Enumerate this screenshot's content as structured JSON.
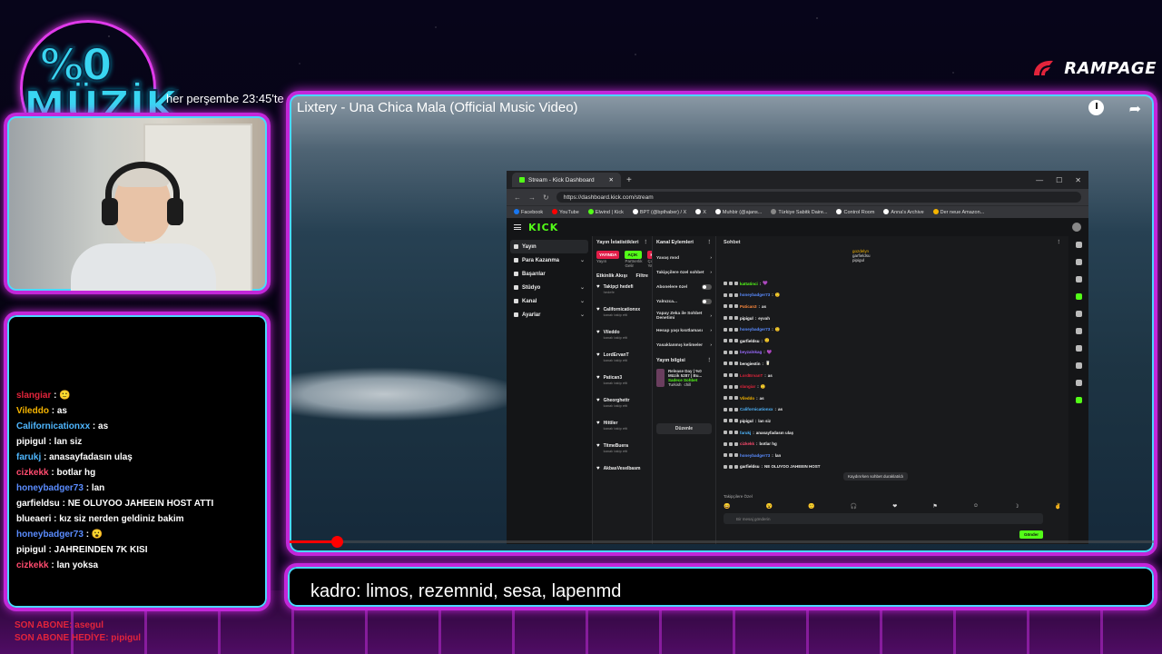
{
  "overlay": {
    "logo_top": "%0",
    "logo_bottom": "MÜZİK",
    "schedule": "her perşembe 23:45'te",
    "brand": "RAMPAGE",
    "caption": "kadro: limos, rezemnid, sesa, lapenmd",
    "subs": {
      "last_sub": "SON ABONE: asegul",
      "last_gift": "SON ABONE HEDİYE: pipigul"
    }
  },
  "stream_chat": [
    {
      "user": "slangiar",
      "color": "#e2243b",
      "msg": "🙂"
    },
    {
      "user": "Vileddo",
      "color": "#f5b400",
      "msg": "as"
    },
    {
      "user": "Californicationxx",
      "color": "#4fb7ff",
      "msg": "as"
    },
    {
      "user": "pipigul",
      "color": "#ffffff",
      "msg": "lan siz"
    },
    {
      "user": "farukj",
      "color": "#4fb7ff",
      "msg": "anasayfadasın ulaş"
    },
    {
      "user": "cizkekk",
      "color": "#ff4b6e",
      "msg": "botlar hg"
    },
    {
      "user": "honeybadger73",
      "color": "#5a8cff",
      "msg": "lan"
    },
    {
      "user": "garfieldsu",
      "color": "#ffffff",
      "msg": "NE OLUYOO JAHEEIN HOST ATTI"
    },
    {
      "user": "blueaeri",
      "color": "#ffffff",
      "msg": "kız siz nerden geldiniz bakim"
    },
    {
      "user": "honeybadger73",
      "color": "#5a8cff",
      "msg": "😮"
    },
    {
      "user": "pipigul",
      "color": "#ffffff",
      "msg": "JAHREINDEN 7K KISI"
    },
    {
      "user": "cizkekk",
      "color": "#ff4b6e",
      "msg": "lan yoksa"
    }
  ],
  "video": {
    "title": "Lixtery - Una Chica Mala (Official Music Video)",
    "progress": 0.055
  },
  "browser": {
    "tab_title": "Stream - Kick Dashboard",
    "url": "https://dashboard.kick.com/stream",
    "bookmarks": [
      "Facebook",
      "YouTube",
      "Elwind | Kick",
      "BPT (@bpthaber) / X",
      "X",
      "Muhbir (@ajans...",
      "Türkiye Sabitk Daire...",
      "Control Room",
      "Anna's Archive",
      "Der neue Amazon..."
    ],
    "logo": "KICK",
    "sidebar": [
      {
        "label": "Yayın",
        "chev": "",
        "active": true
      },
      {
        "label": "Para Kazanma",
        "chev": "⌄",
        "active": false
      },
      {
        "label": "Başarılar",
        "chev": "",
        "active": false
      },
      {
        "label": "Stüdyo",
        "chev": "⌄",
        "active": false
      },
      {
        "label": "Kanal",
        "chev": "⌄",
        "active": false
      },
      {
        "label": "Ayarlar",
        "chev": "⌄",
        "active": false
      }
    ],
    "stats_title": "Yayın İstatistikleri",
    "stats": [
      {
        "chip": "YAYINDA",
        "sub": "Yayın",
        "color": "red"
      },
      {
        "chip": "AÇIK",
        "sub": "Partnerlik Gelir",
        "color": "green"
      },
      {
        "chip": "KAPALI",
        "sub": "Çoklu Yayın",
        "color": "red"
      },
      {
        "chip": "76",
        "sub": "İzleyici",
        "color": "none"
      }
    ],
    "activity_title": "Etkinlik Akışı",
    "activity_filter": "Filtre",
    "activity": [
      {
        "name": "Takipçi hedefi",
        "sub": "hedefe"
      },
      {
        "name": "Californicationxx",
        "sub": "kanalı takip etti"
      },
      {
        "name": "Vileddo",
        "sub": "kanalı takip etti"
      },
      {
        "name": "LordErvanT",
        "sub": "kanalı takip etti"
      },
      {
        "name": "Patican3",
        "sub": "kanalı takip etti"
      },
      {
        "name": "Gheorghettr",
        "sub": "kanalı takip etti"
      },
      {
        "name": "Hittiler",
        "sub": "kanalı takip etti"
      },
      {
        "name": "TitmeBuera",
        "sub": "kanalı takip etti"
      },
      {
        "name": "AkbasVeselbasm",
        "sub": ""
      }
    ],
    "actions_title": "Kanal Eylemleri",
    "actions": [
      {
        "label": "Yavaş mod",
        "ctl": "›"
      },
      {
        "label": "Takipçilere özel sohbet",
        "ctl": "›"
      },
      {
        "label": "Abonelere özel",
        "ctl": "toggle"
      },
      {
        "label": "Yalnızca...",
        "ctl": "toggle"
      },
      {
        "label": "Yapay Zeka ile Sohbet Denetimi",
        "ctl": "›"
      },
      {
        "label": "Hesap yaşı kısıtlaması",
        "ctl": "›"
      },
      {
        "label": "Yasaklanmış kelimeler",
        "ctl": "›"
      }
    ],
    "info_title": "Yayın bilgisi",
    "info_name": "Release Day | %0 Müzik 5287 | Bu...",
    "info_tag1": "Sadece Sohbet",
    "info_tag2": "Turkish",
    "info_tag3": "chill",
    "edit_label": "Düzenle",
    "chat_title": "Sohbet",
    "pinned": [
      "gozdelyn",
      "garfieldsu",
      "pipigul"
    ],
    "chat_lines": [
      {
        "user": "kattatinci",
        "color": "#53fc18",
        "msg": "💜"
      },
      {
        "user": "honeybadger73",
        "color": "#5a8cff",
        "msg": "🙂"
      },
      {
        "user": "Patican3",
        "color": "#ff8a3d",
        "msg": "as"
      },
      {
        "user": "pipigul",
        "color": "#ffffff",
        "msg": "eyvah"
      },
      {
        "user": "honeybadger73",
        "color": "#5a8cff",
        "msg": "🙂"
      },
      {
        "user": "garfieldsu",
        "color": "#ffffff",
        "msg": "🙂"
      },
      {
        "user": "beyzalnkag",
        "color": "#9b6bff",
        "msg": "💜"
      },
      {
        "user": "bengiestin",
        "color": "#ffffff",
        "msg": "🥛"
      },
      {
        "user": "LordErvanT",
        "color": "#e2243b",
        "msg": "as"
      },
      {
        "user": "slangiar",
        "color": "#e2243b",
        "msg": "🙂"
      },
      {
        "user": "Vileddo",
        "color": "#f5b400",
        "msg": "as"
      },
      {
        "user": "Californicationxx",
        "color": "#4fb7ff",
        "msg": "as"
      },
      {
        "user": "pipigul",
        "color": "#ffffff",
        "msg": "lan siz"
      },
      {
        "user": "farukj",
        "color": "#4fb7ff",
        "msg": "anasayfadasın ulaş"
      },
      {
        "user": "cizkekk",
        "color": "#ff4b6e",
        "msg": "botlar hg"
      },
      {
        "user": "honeybadger73",
        "color": "#5a8cff",
        "msg": "lan"
      },
      {
        "user": "garfieldsu",
        "color": "#ffffff",
        "msg": "NE OLUYOO JAHEEIN HOST"
      }
    ],
    "chat_paused": "Kaydırırken sohbet duraklatıldı",
    "followers_label": "Takipçilere Özel",
    "input_placeholder": "Bir mesaj gönderin",
    "send_label": "Gönder"
  }
}
